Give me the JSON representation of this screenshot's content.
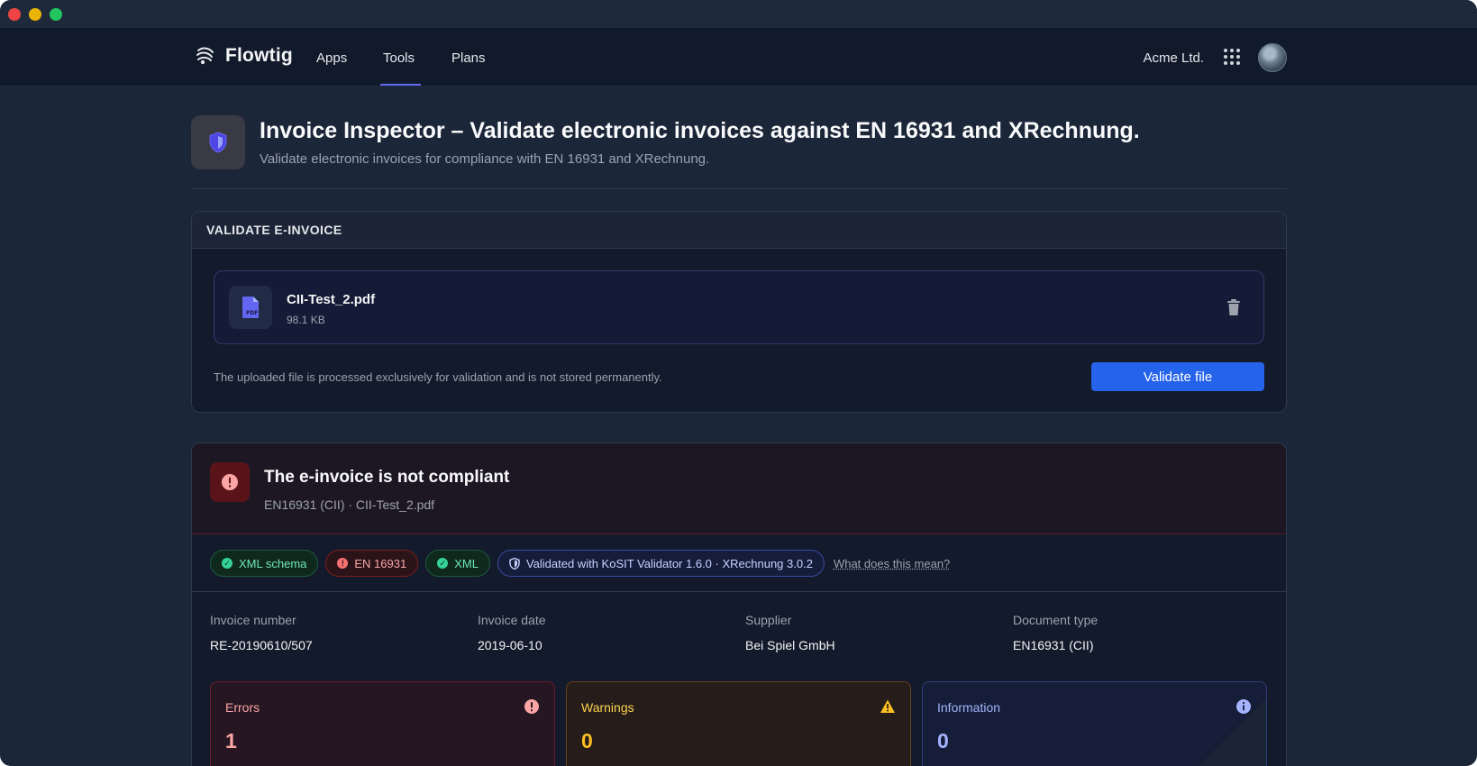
{
  "window": {
    "controls": [
      "close",
      "minimize",
      "maximize"
    ]
  },
  "nav": {
    "brand": "Flowtig",
    "links": [
      {
        "label": "Apps",
        "active": false
      },
      {
        "label": "Tools",
        "active": true
      },
      {
        "label": "Plans",
        "active": false
      }
    ],
    "org": "Acme Ltd.",
    "icons": {
      "apps_grid": "grid-icon",
      "avatar": "user-avatar"
    }
  },
  "header": {
    "title": "Invoice Inspector – Validate electronic invoices against EN 16931 and XRechnung.",
    "subtitle": "Validate electronic invoices for compliance with EN 16931 and XRechnung.",
    "icon": "shield-icon"
  },
  "upload": {
    "section_title": "VALIDATE E-INVOICE",
    "file": {
      "name": "CII-Test_2.pdf",
      "size": "98.1 KB",
      "icon": "pdf-file-icon"
    },
    "note": "The uploaded file is processed exclusively for validation and is not stored permanently.",
    "button": "Validate file"
  },
  "result": {
    "title": "The e-invoice is not compliant",
    "subtitle": "EN16931 (CII) · CII-Test_2.pdf",
    "badges": [
      {
        "label": "XML schema",
        "status": "ok"
      },
      {
        "label": "EN 16931",
        "status": "error"
      },
      {
        "label": "XML",
        "status": "ok"
      },
      {
        "label": "Validated with KoSIT Validator 1.6.0 · XRechnung 3.0.2",
        "status": "info"
      }
    ],
    "help_link": "What does this mean?",
    "meta": [
      {
        "label": "Invoice number",
        "value": "RE-20190610/507"
      },
      {
        "label": "Invoice date",
        "value": "2019-06-10"
      },
      {
        "label": "Supplier",
        "value": "Bei Spiel GmbH"
      },
      {
        "label": "Document type",
        "value": "EN16931 (CII)"
      }
    ],
    "stats": [
      {
        "label": "Errors",
        "value": "1",
        "icon": "error-icon"
      },
      {
        "label": "Warnings",
        "value": "0",
        "icon": "warning-icon"
      },
      {
        "label": "Information",
        "value": "0",
        "icon": "info-icon"
      }
    ]
  },
  "colors": {
    "background": "#1b2638",
    "accent": "#6366f1",
    "primary_button": "#2563eb",
    "error": "#f87171",
    "warning": "#fbbf24",
    "success": "#34d399"
  }
}
